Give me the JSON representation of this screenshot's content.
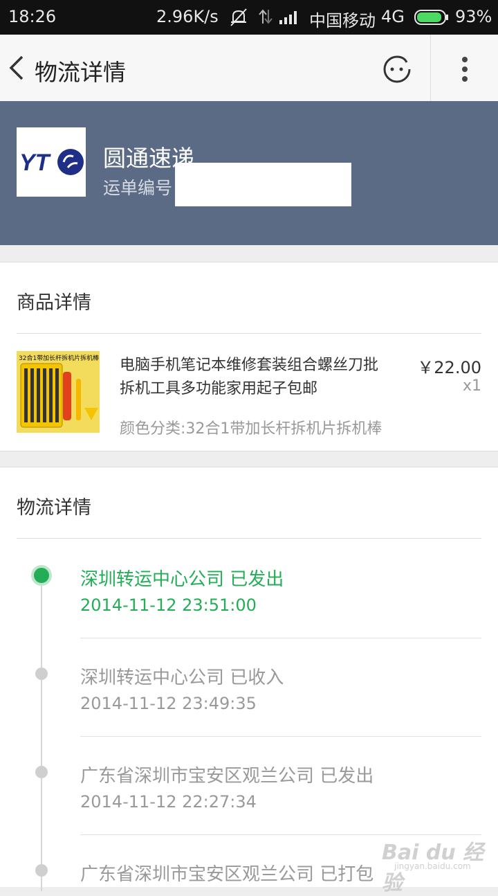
{
  "status_bar": {
    "time": "18:26",
    "speed": "2.96K/s",
    "carrier": "中国移动",
    "network": "4G",
    "battery_percent": "93%",
    "battery_level": 0.93,
    "icons": [
      "mute-icon",
      "data-arrows-icon",
      "signal-icon",
      "battery-icon"
    ]
  },
  "header": {
    "title": "物流详情",
    "icons": [
      "back-arrow-icon",
      "customer-service-icon",
      "more-vertical-icon"
    ]
  },
  "courier": {
    "company": "圆通速递",
    "logo_text": "YTO",
    "waybill_label": "运单编号"
  },
  "product": {
    "section_title": "商品详情",
    "image_caption": "32合1带加长杆拆机片拆机棒",
    "name": "电脑手机笔记本维修套装组合螺丝刀批拆机工具多功能家用起子包邮",
    "price": "￥22.00",
    "quantity": "x1",
    "spec": "颜色分类:32合1带加长杆拆机片拆机棒"
  },
  "logistics": {
    "section_title": "物流详情",
    "events": [
      {
        "desc": "深圳转运中心公司 已发出",
        "time": "2014-11-12 23:51:00",
        "active": true
      },
      {
        "desc": "深圳转运中心公司 已收入",
        "time": "2014-11-12 23:49:35",
        "active": false
      },
      {
        "desc": "广东省深圳市宝安区观兰公司 已发出",
        "time": "2014-11-12 22:27:34",
        "active": false
      },
      {
        "desc": "广东省深圳市宝安区观兰公司 已打包",
        "time": "",
        "active": false
      }
    ]
  },
  "watermark": {
    "main": "Bai du 经验",
    "sub": "jingyan.baidu.com"
  },
  "colors": {
    "banner": "#5b6b85",
    "accent_green": "#22ad56",
    "status_bar": "#111111"
  }
}
